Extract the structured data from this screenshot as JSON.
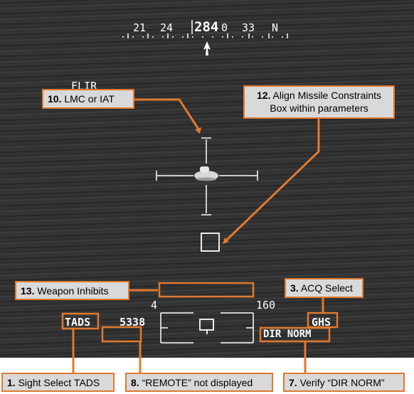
{
  "colors": {
    "accent": "#e07a2e",
    "hud": "#ffffff",
    "callout_bg": "#d9d9d9"
  },
  "heading_tape": {
    "ticks": [
      "21",
      "24",
      "33",
      "N"
    ],
    "current_heading": "284",
    "current_heading_suffix": "0"
  },
  "mode_label": "FLIR",
  "hud": {
    "sight": "TADS",
    "range": "5338",
    "range_low": "4",
    "range_high": "160",
    "acq": "GHS",
    "dir": "DIR NORM"
  },
  "callouts": [
    {
      "num": "10.",
      "text": "LMC or IAT"
    },
    {
      "num": "12.",
      "text": "Align Missile Constraints",
      "text2": "Box within parameters"
    },
    {
      "num": "13.",
      "text": "Weapon Inhibits"
    },
    {
      "num": "3.",
      "text": "ACQ Select"
    },
    {
      "num": "1.",
      "text": "Sight Select TADS"
    },
    {
      "num": "8.",
      "text": "“REMOTE” not displayed"
    },
    {
      "num": "7.",
      "text": "Verify “DIR NORM”"
    }
  ]
}
